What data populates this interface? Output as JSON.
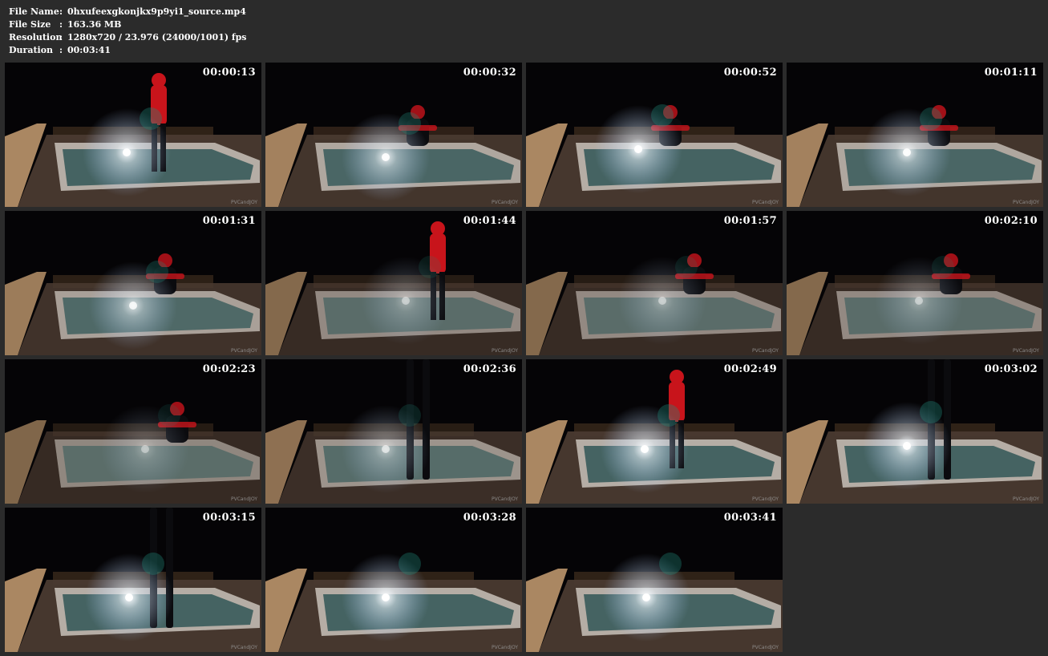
{
  "file_info": {
    "name_label": "File Name",
    "name_value": "0hxufeexgkonjkx9p9yi1_source.mp4",
    "size_label": "File Size",
    "size_value": "163.36 MB",
    "resolution_label": "Resolution",
    "resolution_value": "1280x720 / 23.976 (24000/1001) fps",
    "duration_label": "Duration",
    "duration_value": "00:03:41",
    "separator": ":"
  },
  "thumbnails": [
    {
      "timestamp": "00:00:13",
      "watermark": "PVCandJOY"
    },
    {
      "timestamp": "00:00:32",
      "watermark": "PVCandJOY"
    },
    {
      "timestamp": "00:00:52",
      "watermark": "PVCandJOY"
    },
    {
      "timestamp": "00:01:11",
      "watermark": "PVCandJOY"
    },
    {
      "timestamp": "00:01:31",
      "watermark": "PVCandJOY"
    },
    {
      "timestamp": "00:01:44",
      "watermark": "PVCandJOY"
    },
    {
      "timestamp": "00:01:57",
      "watermark": "PVCandJOY"
    },
    {
      "timestamp": "00:02:10",
      "watermark": "PVCandJOY"
    },
    {
      "timestamp": "00:02:23",
      "watermark": "PVCandJOY"
    },
    {
      "timestamp": "00:02:36",
      "watermark": "PVCandJOY"
    },
    {
      "timestamp": "00:02:49",
      "watermark": "PVCandJOY"
    },
    {
      "timestamp": "00:03:02",
      "watermark": "PVCandJOY"
    },
    {
      "timestamp": "00:03:15",
      "watermark": "PVCandJOY"
    },
    {
      "timestamp": "00:03:28",
      "watermark": "PVCandJOY"
    },
    {
      "timestamp": "00:03:41",
      "watermark": "PVCandJOY"
    }
  ],
  "colors": {
    "page_background": "#2b2b2b",
    "text": "#ffffff",
    "night_sky": "#050406",
    "pool_water": "#3f5f5e",
    "pool_rim": "#c9c2ba",
    "deck_wood": "#b38e67",
    "figure_red": "#c8141b",
    "figure_black": "#0b0b0e"
  }
}
